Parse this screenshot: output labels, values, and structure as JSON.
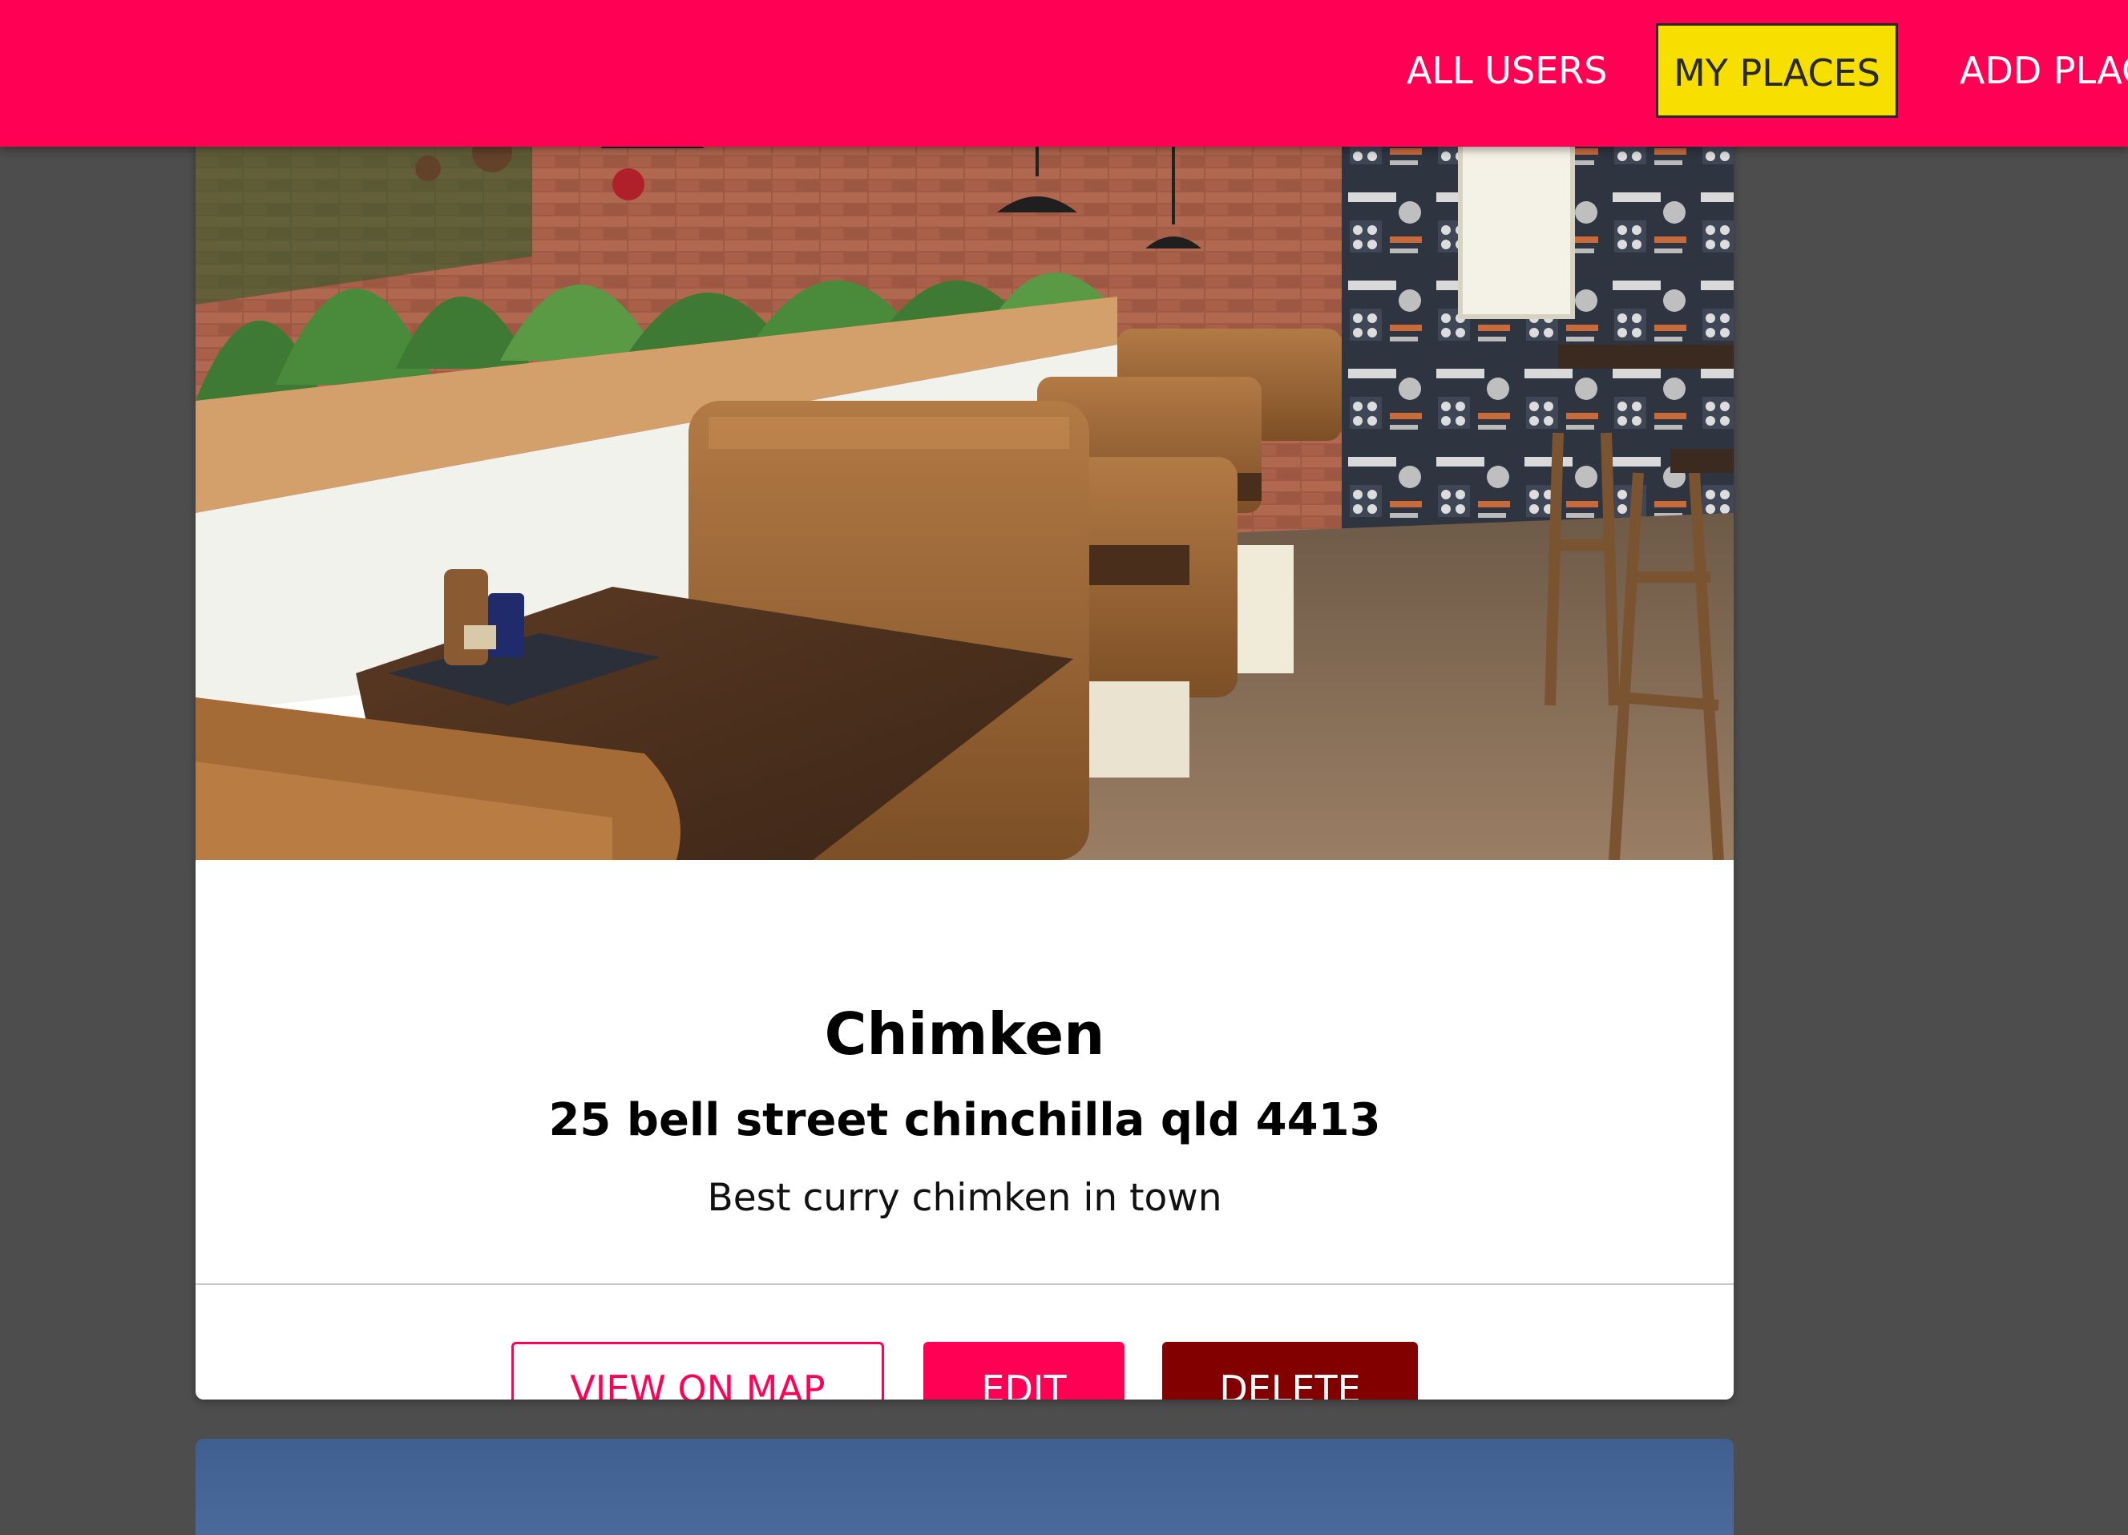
{
  "header": {
    "nav": [
      {
        "label": "ALL USERS"
      },
      {
        "label": "MY PLACES"
      },
      {
        "label": "ADD PLACE"
      }
    ],
    "colors": {
      "header_bg": "#ff0055",
      "active_nav_bg": "#f7df00",
      "page_bg": "#4d4d4d"
    }
  },
  "place": {
    "title": "Chimken",
    "address": "25 bell street chinchilla qld 4413",
    "description": "Best curry chimken in town",
    "image_subject": "restaurant-interior-photo",
    "actions": {
      "view_on_map": "VIEW ON MAP",
      "edit": "EDIT",
      "delete": "DELETE"
    },
    "colors": {
      "primary": "#ff0055",
      "danger": "#830000"
    }
  }
}
